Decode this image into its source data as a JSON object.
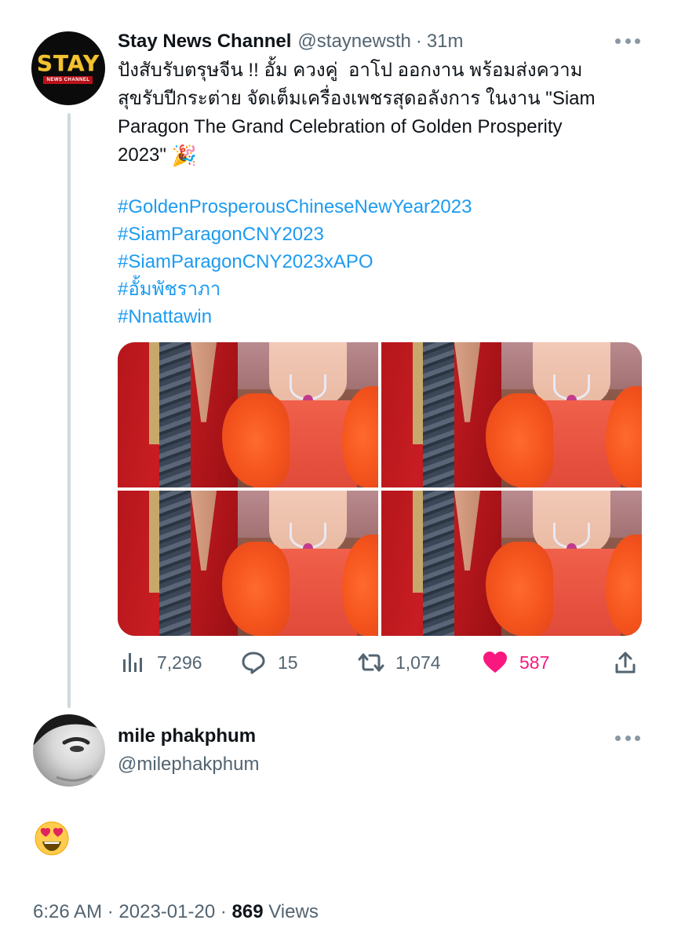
{
  "tweet": {
    "author_name": "Stay News Channel",
    "author_handle": "@staynewsth",
    "separator": "·",
    "time_ago": "31m",
    "avatar_logo_text": "STAY",
    "avatar_logo_sub": "NEWS CHANNEL",
    "text_lines": [
      "ปังสับรับตรุษจีน !! อั้ม ควงคู่  อาโป ออกงาน พร้อมส่งความ",
      "สุขรับปีกระต่าย จัดเต็มเครื่องเพชรสุดอลังการ ในงาน \"Siam",
      "Paragon The Grand Celebration of Golden Prosperity",
      "2023\""
    ],
    "emoji": "🎉",
    "hashtags": [
      "#GoldenProsperousChineseNewYear2023",
      "#SiamParagonCNY2023",
      "#SiamParagonCNY2023xAPO",
      "#อั้มพัชราภา",
      "#Nnattawin"
    ],
    "media_count": 4,
    "stats": {
      "views": "7,296",
      "replies": "15",
      "retweets": "1,074",
      "likes": "587"
    },
    "like_color": "#f91880"
  },
  "reply": {
    "author_name": "mile phakphum",
    "author_handle": "@milephakphum",
    "emoji": "😍",
    "timestamp": "6:26 AM",
    "date": "2023-01-20",
    "separator": "·",
    "views_count": "869",
    "views_label": "Views"
  },
  "colors": {
    "link": "#1d9bf0",
    "muted": "#536471",
    "text": "#0f1419",
    "thread_line": "#cfd9de"
  }
}
